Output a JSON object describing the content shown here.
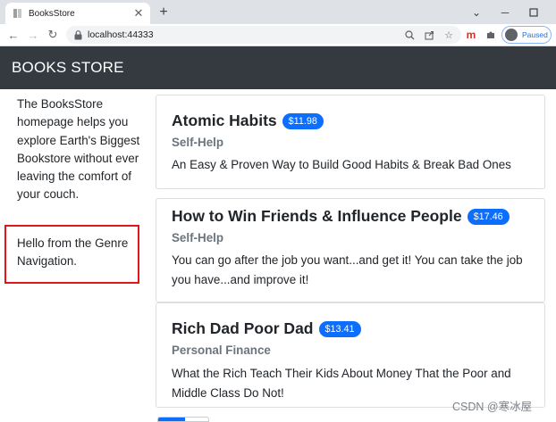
{
  "browser": {
    "tab_title": "BooksStore",
    "url": "localhost:44333",
    "profile_label": "Paused",
    "extension_label": "m"
  },
  "navbar": {
    "brand": "BOOKS STORE"
  },
  "sidebar": {
    "description": "The BooksStore homepage helps you explore Earth's Biggest Bookstore without ever leaving the comfort of your couch.",
    "genre_navigation": "Hello from the Genre Navigation."
  },
  "books": [
    {
      "title": "Atomic Habits",
      "price": "$11.98",
      "category": "Self-Help",
      "description": "An Easy & Proven Way to Build Good Habits & Break Bad Ones"
    },
    {
      "title": "How to Win Friends & Influence People",
      "price": "$17.46",
      "category": "Self-Help",
      "description": "You can go after the job you want...and get it! You can take the job you have...and improve it!"
    },
    {
      "title": "Rich Dad Poor Dad",
      "price": "$13.41",
      "category": "Personal Finance",
      "description": "What the Rich Teach Their Kids About Money That the Poor and Middle Class Do Not!"
    }
  ],
  "watermark": "CSDN @寒冰屋",
  "colors": {
    "navbar": "#343a40",
    "price_badge": "#0d6efd",
    "highlight_border": "#e0161b",
    "category_text": "#6c757d"
  }
}
